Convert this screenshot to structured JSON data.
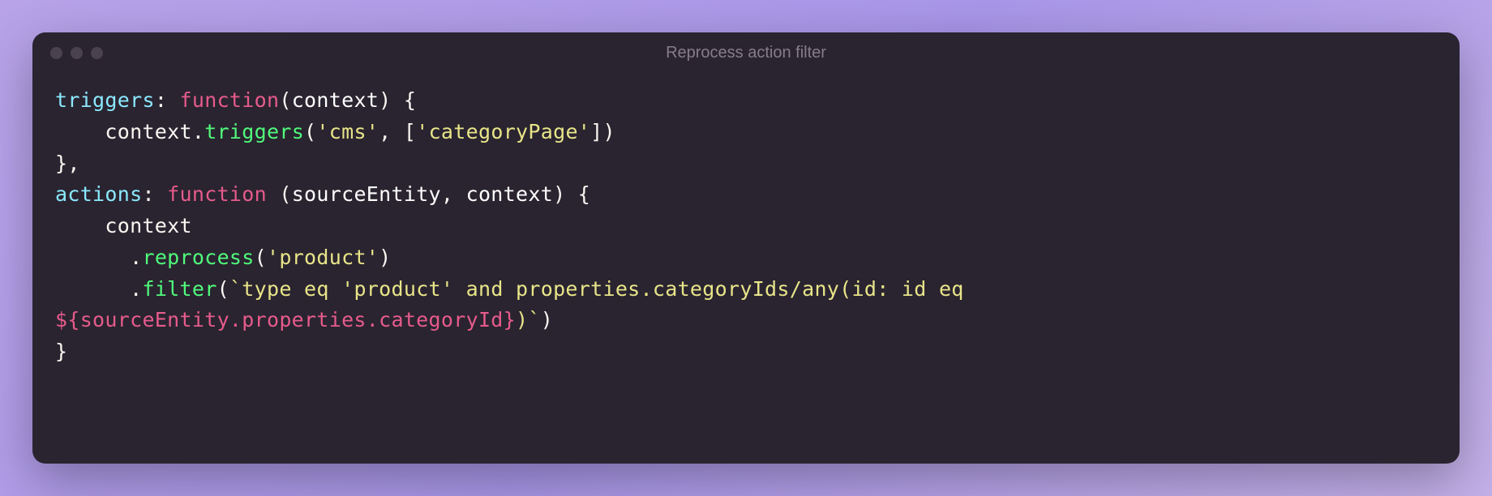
{
  "window": {
    "title": "Reprocess action filter"
  },
  "code": {
    "line1": {
      "prop": "triggers",
      "keyword": "function",
      "param": "context",
      "open": "("
    },
    "line2": {
      "obj": "context",
      "method": "triggers",
      "arg1": "'cms'",
      "arg2": "'categoryPage'"
    },
    "line3": {
      "close": "},"
    },
    "line4": {
      "prop": "actions",
      "keyword": "function",
      "param1": "sourceEntity",
      "param2": "context"
    },
    "line5": {
      "obj": "context"
    },
    "line6": {
      "method": "reprocess",
      "arg": "'product'"
    },
    "line7": {
      "method": "filter",
      "str": "`type eq 'product' and properties.categoryIds/any(id: id eq "
    },
    "line8": {
      "interp1": "${",
      "interpExpr": "sourceEntity.properties.categoryId",
      "interp2": "}",
      "strClose": ")`"
    },
    "line9": {
      "close": "}"
    }
  }
}
